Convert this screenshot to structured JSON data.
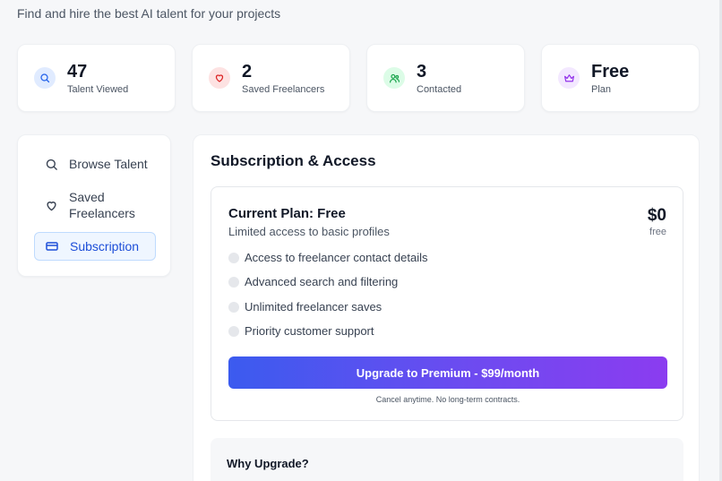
{
  "header": {
    "subtitle": "Find and hire the best AI talent for your projects"
  },
  "stats": [
    {
      "value": "47",
      "label": "Talent Viewed",
      "icon": "search-icon",
      "color": "#2563eb",
      "bg": "#e0ebff"
    },
    {
      "value": "2",
      "label": "Saved Freelancers",
      "icon": "heart-icon",
      "color": "#dc2626",
      "bg": "#fde2e2"
    },
    {
      "value": "3",
      "label": "Contacted",
      "icon": "users-icon",
      "color": "#16a34a",
      "bg": "#dcfce7"
    },
    {
      "value": "Free",
      "label": "Plan",
      "icon": "crown-icon",
      "color": "#9333ea",
      "bg": "#f3e8ff"
    }
  ],
  "sidebar": {
    "items": [
      {
        "label": "Browse Talent",
        "icon": "search-icon",
        "active": false
      },
      {
        "label": "Saved Freelancers",
        "icon": "heart-icon",
        "active": false
      },
      {
        "label": "Subscription",
        "icon": "credit-card-icon",
        "active": true
      }
    ]
  },
  "main": {
    "title": "Subscription & Access",
    "plan": {
      "title": "Current Plan: Free",
      "description": "Limited access to basic profiles",
      "price": "$0",
      "price_note": "free",
      "features": [
        "Access to freelancer contact details",
        "Advanced search and filtering",
        "Unlimited freelancer saves",
        "Priority customer support"
      ],
      "upgrade_label": "Upgrade to Premium - $99/month",
      "cancel_note": "Cancel anytime. No long-term contracts."
    },
    "why": {
      "title": "Why Upgrade?"
    }
  },
  "colors": {
    "accent": "#1d4ed8",
    "button_gradient_start": "#3b5bef",
    "button_gradient_end": "#8b3cf0"
  }
}
